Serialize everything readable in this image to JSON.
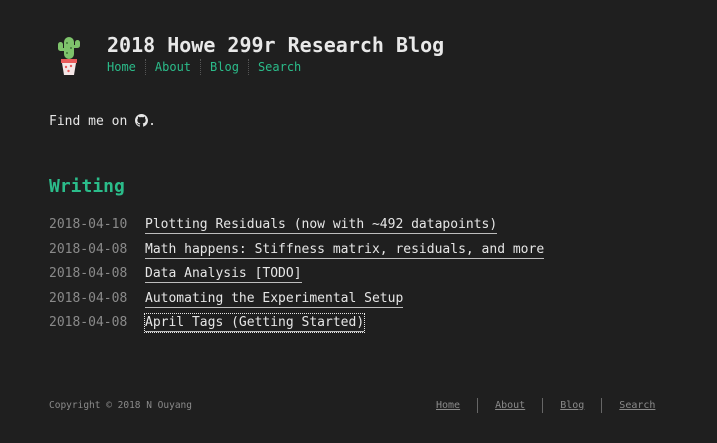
{
  "header": {
    "title": "2018 Howe 299r Research Blog",
    "logo_icon": "cactus-icon",
    "nav": [
      "Home",
      "About",
      "Blog",
      "Search"
    ]
  },
  "intro": {
    "prefix": "Find me on",
    "icon": "github-icon",
    "suffix": "."
  },
  "writing": {
    "title": "Writing",
    "posts": [
      {
        "date": "2018-04-10",
        "title": "Plotting Residuals (now with ~492 datapoints)"
      },
      {
        "date": "2018-04-08",
        "title": "Math happens: Stiffness matrix, residuals, and more"
      },
      {
        "date": "2018-04-08",
        "title": "Data Analysis [TODO]"
      },
      {
        "date": "2018-04-08",
        "title": "Automating the Experimental Setup"
      },
      {
        "date": "2018-04-08",
        "title": "April Tags (Getting Started)"
      }
    ]
  },
  "footer": {
    "copyright": "Copyright © 2018 N Ouyang",
    "nav": [
      "Home",
      "About",
      "Blog",
      "Search"
    ]
  },
  "colors": {
    "background": "#1f1f1f",
    "accent": "#2bbc8a",
    "text": "#e6e6e6",
    "muted": "#8a8a8a"
  }
}
